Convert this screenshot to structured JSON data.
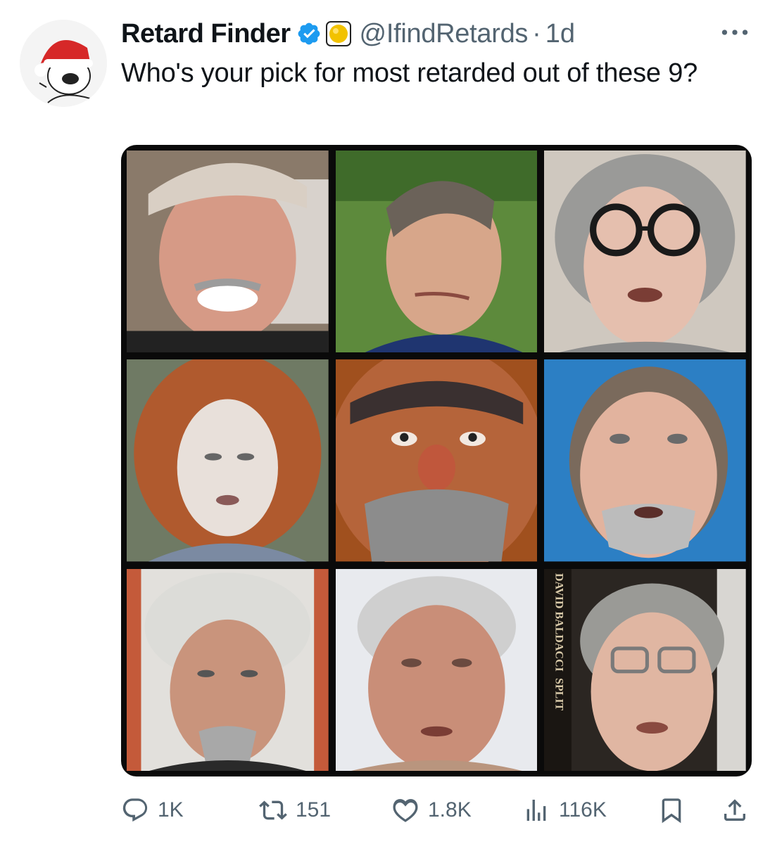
{
  "tweet": {
    "author_name": "Retard Finder",
    "handle": "@IfindRetards",
    "separator": "·",
    "time": "1d",
    "text": "Who's your pick for most retarded out of these 9?",
    "media": {
      "photo_labels": [
        {
          "text": "DAVID BALDACCI",
          "photo_index": 8
        },
        {
          "text": "SPLIT",
          "photo_index": 8
        }
      ]
    }
  },
  "actions": {
    "replies": "1K",
    "reposts": "151",
    "likes": "1.8K",
    "views": "116K"
  },
  "icons": {
    "verified": "verified-badge-icon",
    "affiliate": "gold-circle-icon",
    "more": "more-horizontal-icon",
    "reply": "reply-icon",
    "repost": "repost-icon",
    "like": "heart-icon",
    "views": "views-bar-icon",
    "bookmark": "bookmark-icon",
    "share": "share-icon"
  },
  "colors": {
    "verified": "#1d9bf0",
    "secondary_text": "#536471",
    "gold": "#f2c200"
  }
}
